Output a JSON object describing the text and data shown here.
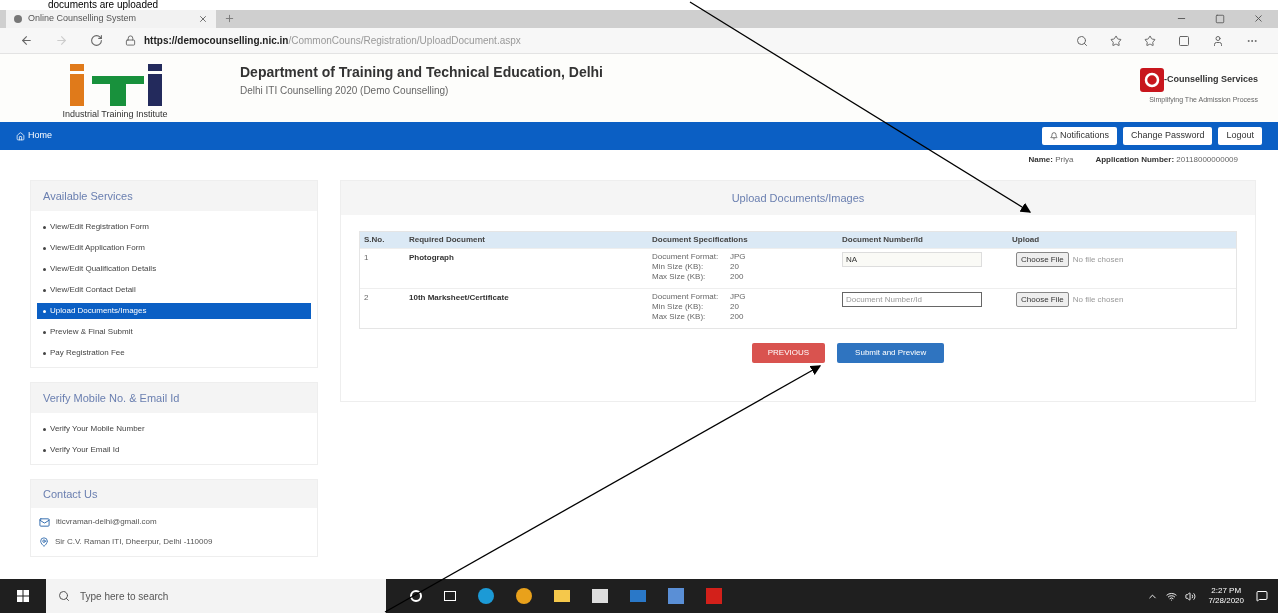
{
  "annotation": {
    "text": "documents are uploaded"
  },
  "browser": {
    "tab": {
      "title": "Online Counselling System"
    },
    "url_host": "https://democounselling.nic.in",
    "url_path": "/CommonCouns/Registration/UploadDocument.aspx"
  },
  "header": {
    "logo_caption": "Industrial Training Institute",
    "title": "Department of Training and Technical Education, Delhi",
    "subtitle": "Delhi ITI Counselling 2020 (Demo Counselling)",
    "brand_name": "-Counselling Services",
    "brand_tagline": "Simplifying The Admission Process"
  },
  "nav": {
    "home": "Home",
    "buttons": [
      "Notifications",
      "Change Password",
      "Logout"
    ]
  },
  "applicant": {
    "name_label": "Name:",
    "name": "Priya",
    "number_label": "Application Number:",
    "number": "20118000000009"
  },
  "sidebar": [
    {
      "title": "Available Services",
      "items": [
        {
          "label": "View/Edit Registration Form",
          "selected": false
        },
        {
          "label": "View/Edit Application Form",
          "selected": false
        },
        {
          "label": "View/Edit Qualification Details",
          "selected": false
        },
        {
          "label": "View/Edit Contact Detail",
          "selected": false
        },
        {
          "label": "Upload Documents/Images",
          "selected": true
        },
        {
          "label": "Preview & Final Submit",
          "selected": false
        },
        {
          "label": "Pay Registration Fee",
          "selected": false
        }
      ]
    },
    {
      "title": "Verify Mobile No. & Email Id",
      "items": [
        {
          "label": "Verify Your Mobile Number",
          "selected": false
        },
        {
          "label": "Verify Your Email Id",
          "selected": false
        }
      ]
    }
  ],
  "contact": {
    "title": "Contact Us",
    "email": "iticvraman-delhi@gmail.com",
    "address": "Sir C.V. Raman ITI, Dheerpur, Delhi -110009"
  },
  "upload": {
    "title": "Upload Documents/Images",
    "columns": [
      "S.No.",
      "Required Document",
      "Document Specifications",
      "Document Number/Id",
      "Upload"
    ],
    "rows": [
      {
        "sno": "1",
        "document": "Photograph",
        "specs": [
          [
            "Document Format:",
            "JPG"
          ],
          [
            "Min Size (KB):",
            "20"
          ],
          [
            "Max Size (KB):",
            "200"
          ]
        ],
        "number_value": "NA",
        "number_placeholder": "",
        "file_button": "Choose File",
        "file_status": "No file chosen"
      },
      {
        "sno": "2",
        "document": "10th Marksheet/Certificate",
        "specs": [
          [
            "Document Format:",
            "JPG"
          ],
          [
            "Min Size (KB):",
            "20"
          ],
          [
            "Max Size (KB):",
            "200"
          ]
        ],
        "number_value": "",
        "number_placeholder": "Document Number/Id",
        "file_button": "Choose File",
        "file_status": "No file chosen"
      }
    ],
    "previous_button": "PREVIOUS",
    "submit_button": "Submit and Preview"
  },
  "taskbar": {
    "search_placeholder": "Type here to search",
    "time": "2:27 PM",
    "date": "7/28/2020"
  }
}
